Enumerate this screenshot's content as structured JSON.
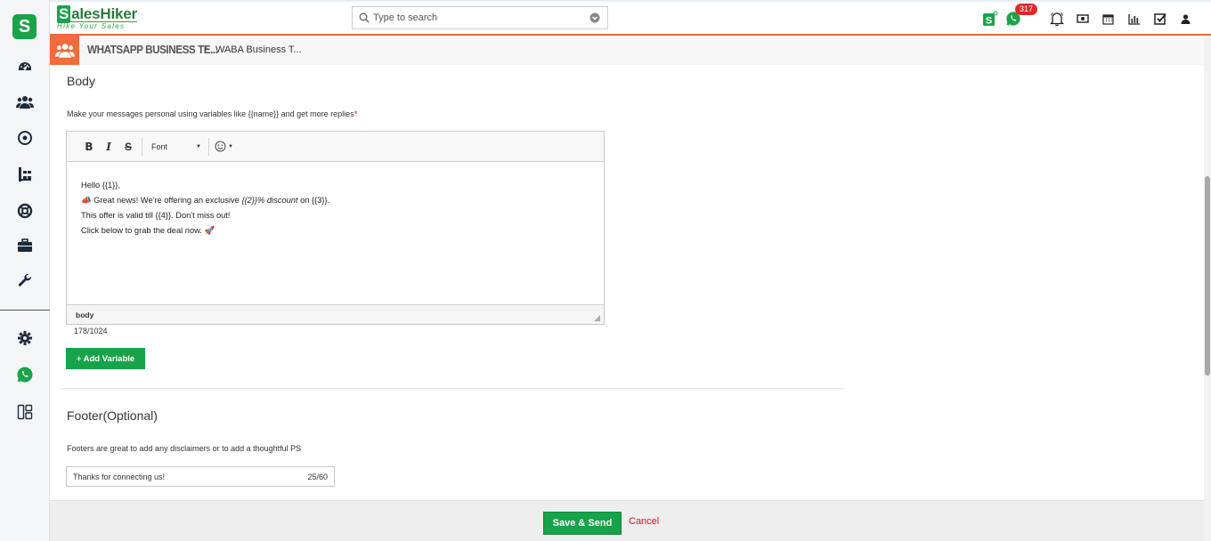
{
  "app": {
    "brand_name": "SalesHiker",
    "brand_s": "S",
    "brand_rest": "alesHiker",
    "tagline": "Hike Your Sales",
    "sidebar_logo": "S"
  },
  "search": {
    "placeholder": "Type to search"
  },
  "header": {
    "notifications_count": "317"
  },
  "breadcrumb": {
    "main": "WHATSAPP BUSINESS TE...",
    "sub": "WABA Business T..."
  },
  "sidebar": {
    "items": [
      {
        "name": "dashboard-icon"
      },
      {
        "name": "users-icon"
      },
      {
        "name": "target-icon"
      },
      {
        "name": "sitemap-icon"
      },
      {
        "name": "lifebuoy-icon"
      },
      {
        "name": "briefcase-icon"
      },
      {
        "name": "wrench-icon"
      },
      {
        "name": "settings-icon"
      },
      {
        "name": "whatsapp-icon"
      },
      {
        "name": "layout-icon"
      }
    ]
  },
  "body_section": {
    "title": "Body",
    "hint": "Make your messages personal using variables like {{name}} and get more replies",
    "required_mark": "*",
    "toolbar": {
      "bold": "B",
      "italic": "I",
      "strike": "S",
      "font_label": "Font"
    },
    "lines": {
      "l1": "Hello {{1}},",
      "l2_emoji": "📣",
      "l2_a": " Great news! We're offering an exclusive ",
      "l2_b": "{{2}}% discount",
      "l2_c": " on {{3}}.",
      "l3": "This offer is valid till {{4}}. Don't miss out!",
      "l4": "Click below to grab the deal now. ",
      "l4_emoji": "🚀"
    },
    "status_path": "body",
    "char_count": "178/1024",
    "add_variable": "+ Add Variable"
  },
  "footer_section": {
    "title": "Footer(Optional)",
    "hint": "Footers are great to add any disclaimers or to add a thoughtful PS",
    "value": "Thanks for connecting us!",
    "char_count": "25/60"
  },
  "actions": {
    "save": "Save & Send",
    "cancel": "Cancel"
  },
  "colors": {
    "accent": "#f26b3a",
    "primary": "#16a34a",
    "danger": "#d9142b"
  }
}
